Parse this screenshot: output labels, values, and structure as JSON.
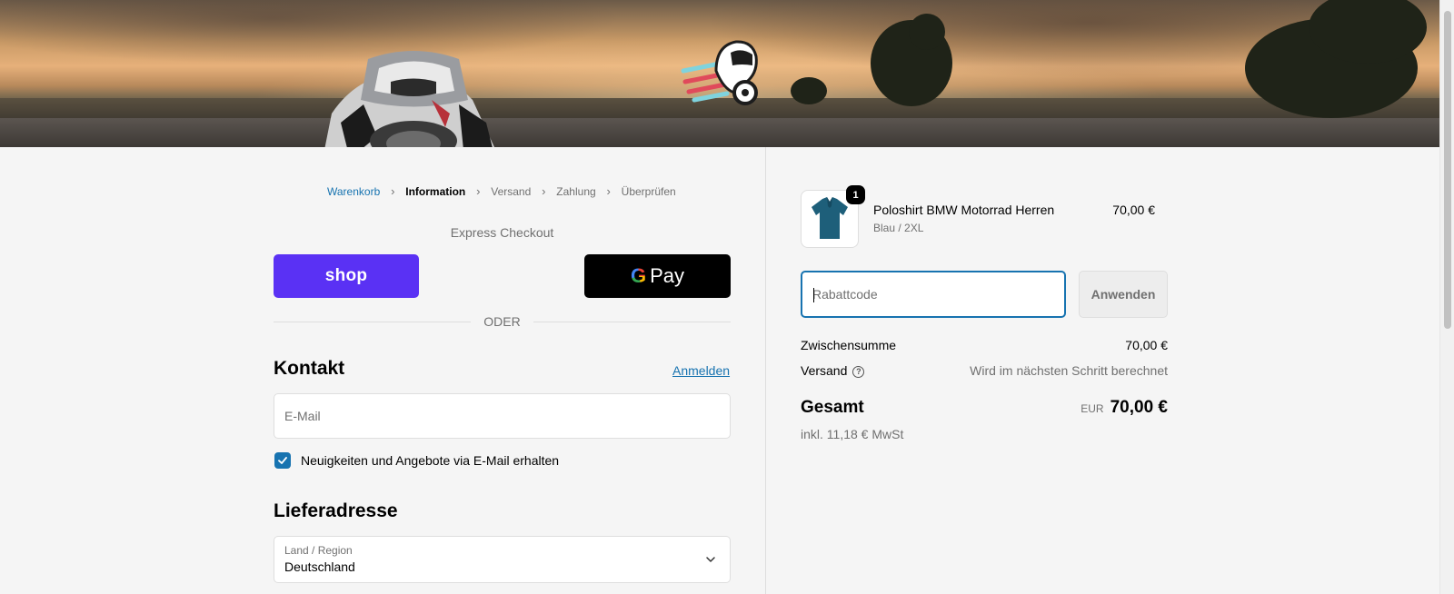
{
  "breadcrumb": [
    {
      "label": "Warenkorb",
      "state": "link"
    },
    {
      "label": "Information",
      "state": "active"
    },
    {
      "label": "Versand",
      "state": "upcoming"
    },
    {
      "label": "Zahlung",
      "state": "upcoming"
    },
    {
      "label": "Überprüfen",
      "state": "upcoming"
    }
  ],
  "express": {
    "title": "Express Checkout",
    "shop_label": "shop",
    "gpay_label": "Pay",
    "or_label": "ODER"
  },
  "contact": {
    "title": "Kontakt",
    "login_link": "Anmelden",
    "email_placeholder": "E-Mail",
    "newsletter_label": "Neuigkeiten und Angebote via E-Mail erhalten",
    "newsletter_checked": true
  },
  "shipping_address": {
    "title": "Lieferadresse",
    "country_label": "Land / Region",
    "country_value": "Deutschland"
  },
  "order": {
    "item": {
      "quantity": "1",
      "name": "Poloshirt BMW Motorrad Herren",
      "variant": "Blau / 2XL",
      "price": "70,00 €"
    },
    "discount_placeholder": "Rabattcode",
    "apply_label": "Anwenden",
    "subtotal_label": "Zwischensumme",
    "subtotal_value": "70,00 €",
    "shipping_label": "Versand",
    "shipping_value": "Wird im nächsten Schritt berechnet",
    "total_label": "Gesamt",
    "total_currency": "EUR",
    "total_value": "70,00 €",
    "tax_note": "inkl. 11,18 € MwSt"
  },
  "colors": {
    "accent": "#1773b0",
    "shop_pay": "#5a31f4",
    "gpay": "#000000",
    "muted_text": "#707070"
  }
}
